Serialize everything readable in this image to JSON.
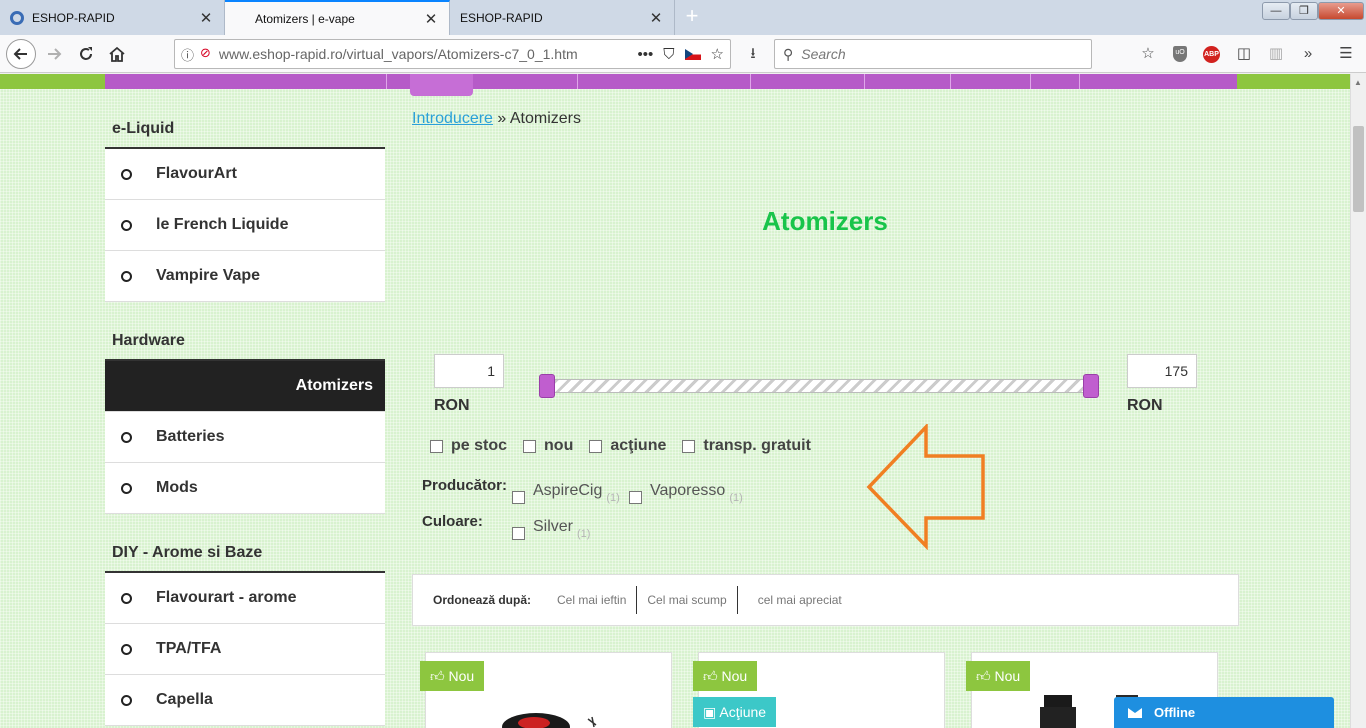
{
  "browser": {
    "tabs": [
      {
        "label": "ESHOP-RAPID",
        "close": "✕"
      },
      {
        "label": "Atomizers | e-vape",
        "close": "✕"
      },
      {
        "label": "ESHOP-RAPID",
        "close": "✕"
      }
    ],
    "new_tab": "+",
    "url": "www.eshop-rapid.ro/virtual_vapors/Atomizers-c7_0_1.htm",
    "search_placeholder": "Search",
    "page_actions": "•••",
    "icons": {
      "back": "arrow-left-icon",
      "forward": "arrow-right-icon",
      "reload": "reload-icon",
      "home": "home-icon",
      "download": "download-icon",
      "library": "library-icon",
      "menu": "hamburger-menu-icon"
    },
    "extensions": {
      "ublock": "uO",
      "abp": "ABP"
    },
    "window_controls": {
      "minimize": "—",
      "maximize": "❐",
      "close": "✕"
    }
  },
  "sidebar": {
    "sections": [
      {
        "title": "e-Liquid",
        "items": [
          {
            "label": "FlavourArt"
          },
          {
            "label": "le French Liquide"
          },
          {
            "label": "Vampire Vape"
          }
        ]
      },
      {
        "title": "Hardware",
        "items": [
          {
            "label": "Atomizers",
            "active": true
          },
          {
            "label": "Batteries"
          },
          {
            "label": "Mods"
          }
        ]
      },
      {
        "title": "DIY - Arome si Baze",
        "items": [
          {
            "label": "Flavourart - arome"
          },
          {
            "label": "TPA/TFA"
          },
          {
            "label": "Capella"
          }
        ]
      }
    ]
  },
  "breadcrumb": {
    "home": "Introducere",
    "separator": "»",
    "current": "Atomizers"
  },
  "page_title": "Atomizers",
  "price_filter": {
    "min_value": "1",
    "max_value": "175",
    "currency": "RON"
  },
  "flags": [
    {
      "label": "pe stoc"
    },
    {
      "label": "nou"
    },
    {
      "label": "acţiune"
    },
    {
      "label": "transp. gratuit"
    }
  ],
  "filters": {
    "producer_label": "Producător:",
    "producers": [
      {
        "label": "AspireCig",
        "count": "(1)"
      },
      {
        "label": "Vaporesso",
        "count": "(1)"
      }
    ],
    "color_label": "Culoare:",
    "colors": [
      {
        "label": "Silver",
        "count": "(1)"
      }
    ]
  },
  "sort": {
    "label": "Ordonează după:",
    "options": [
      "Cel mai ieftin",
      "Cel mai scump",
      "cel mai apreciat"
    ]
  },
  "products": [
    {
      "badges": [
        "Nou"
      ]
    },
    {
      "badges": [
        "Nou",
        "Acţiune"
      ]
    },
    {
      "badges": [
        "Nou"
      ]
    }
  ],
  "chat": {
    "label": "Offline"
  },
  "colors": {
    "accent_green": "#18c44a",
    "menu_purple": "#b65bc8",
    "nou_badge": "#8dc63f",
    "action_badge": "#3cc8c8",
    "chat_blue": "#1e8fe0",
    "arrow_orange": "#f07f22"
  }
}
